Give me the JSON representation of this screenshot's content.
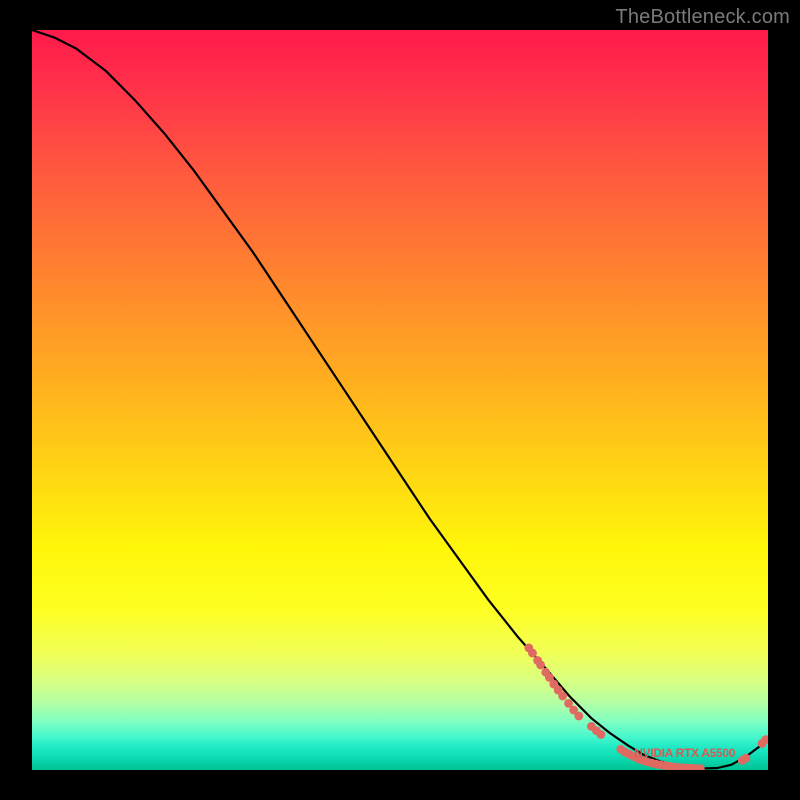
{
  "watermark": "TheBottleneck.com",
  "model_label": "NVIDIA RTX A5500",
  "colors": {
    "dot": "#e06a61",
    "label": "#d85a52",
    "curve": "#000000"
  },
  "chart_data": {
    "type": "line",
    "title": "",
    "xlabel": "",
    "ylabel": "",
    "xlim": [
      0,
      100
    ],
    "ylim": [
      0,
      100
    ],
    "grid": false,
    "legend": false,
    "series": [
      {
        "name": "bottleneck-curve",
        "x": [
          0,
          3,
          6,
          10,
          14,
          18,
          22,
          26,
          30,
          34,
          38,
          42,
          46,
          50,
          54,
          58,
          62,
          66,
          70,
          73,
          76,
          78.5,
          81,
          83,
          85,
          87,
          89,
          91,
          93,
          95,
          97,
          99,
          100
        ],
        "y": [
          100,
          99,
          97.5,
          94.5,
          90.5,
          86,
          81,
          75.5,
          70,
          64,
          58,
          52,
          46,
          40,
          34,
          28.5,
          23,
          18,
          13.5,
          10,
          7,
          5,
          3.3,
          2.1,
          1.3,
          0.7,
          0.35,
          0.2,
          0.25,
          0.7,
          1.8,
          3.3,
          4.4
        ]
      }
    ],
    "highlight_dots": [
      {
        "x": 67.5,
        "y": 16.5
      },
      {
        "x": 68.0,
        "y": 15.8
      },
      {
        "x": 68.7,
        "y": 14.8
      },
      {
        "x": 69.1,
        "y": 14.2
      },
      {
        "x": 69.8,
        "y": 13.2
      },
      {
        "x": 70.3,
        "y": 12.5
      },
      {
        "x": 70.9,
        "y": 11.6
      },
      {
        "x": 71.5,
        "y": 10.8
      },
      {
        "x": 72.1,
        "y": 10.0
      },
      {
        "x": 72.9,
        "y": 9.0
      },
      {
        "x": 73.6,
        "y": 8.1
      },
      {
        "x": 74.3,
        "y": 7.3
      },
      {
        "x": 76.0,
        "y": 5.9
      },
      {
        "x": 76.7,
        "y": 5.3
      },
      {
        "x": 77.3,
        "y": 4.8
      },
      {
        "x": 80.0,
        "y": 2.8
      },
      {
        "x": 80.6,
        "y": 2.4
      },
      {
        "x": 81.2,
        "y": 2.1
      },
      {
        "x": 81.8,
        "y": 1.8
      },
      {
        "x": 82.4,
        "y": 1.5
      },
      {
        "x": 83.0,
        "y": 1.3
      },
      {
        "x": 83.6,
        "y": 1.1
      },
      {
        "x": 84.2,
        "y": 0.95
      },
      {
        "x": 84.8,
        "y": 0.8
      },
      {
        "x": 85.4,
        "y": 0.7
      },
      {
        "x": 86.0,
        "y": 0.6
      },
      {
        "x": 86.6,
        "y": 0.5
      },
      {
        "x": 87.2,
        "y": 0.42
      },
      {
        "x": 87.8,
        "y": 0.36
      },
      {
        "x": 88.4,
        "y": 0.3
      },
      {
        "x": 89.0,
        "y": 0.26
      },
      {
        "x": 89.6,
        "y": 0.23
      },
      {
        "x": 90.2,
        "y": 0.21
      },
      {
        "x": 90.8,
        "y": 0.2
      },
      {
        "x": 96.5,
        "y": 1.3
      },
      {
        "x": 97.0,
        "y": 1.6
      },
      {
        "x": 99.2,
        "y": 3.6
      },
      {
        "x": 99.7,
        "y": 4.1
      }
    ]
  }
}
